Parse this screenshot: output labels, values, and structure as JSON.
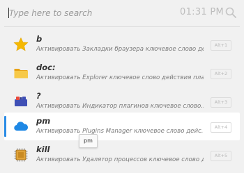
{
  "search": {
    "placeholder": "Type here to search",
    "value": "",
    "clock": "01:31 PM",
    "icon": "search-icon"
  },
  "results": [
    {
      "title": "b",
      "description": "Активировать Закладки браузера ключевое слово дейс...",
      "hotkey": "Alt+1",
      "icon": "star-icon",
      "selected": false
    },
    {
      "title": "doc:",
      "description": "Активировать Explorer ключевое слово действия пла...",
      "hotkey": "Alt+2",
      "icon": "folder-icon",
      "selected": false
    },
    {
      "title": "?",
      "description": "Активировать Индикатор плагинов ключевое слово...",
      "hotkey": "Alt+3",
      "icon": "plugin-blocks-icon",
      "selected": false
    },
    {
      "title": "pm",
      "description": "Активировать Plugins Manager ключевое слово дейс...",
      "hotkey": "Alt+4",
      "icon": "cloud-icon",
      "selected": true
    },
    {
      "title": "kill",
      "description": "Активировать Удалятор процессов ключевое слово д...",
      "hotkey": "Alt+5",
      "icon": "cpu-chip-icon",
      "selected": false
    }
  ],
  "tooltip": "pm",
  "colors": {
    "accent": "#2b8ce6",
    "background": "#f1f1f1",
    "selected_row": "#ffffff"
  }
}
